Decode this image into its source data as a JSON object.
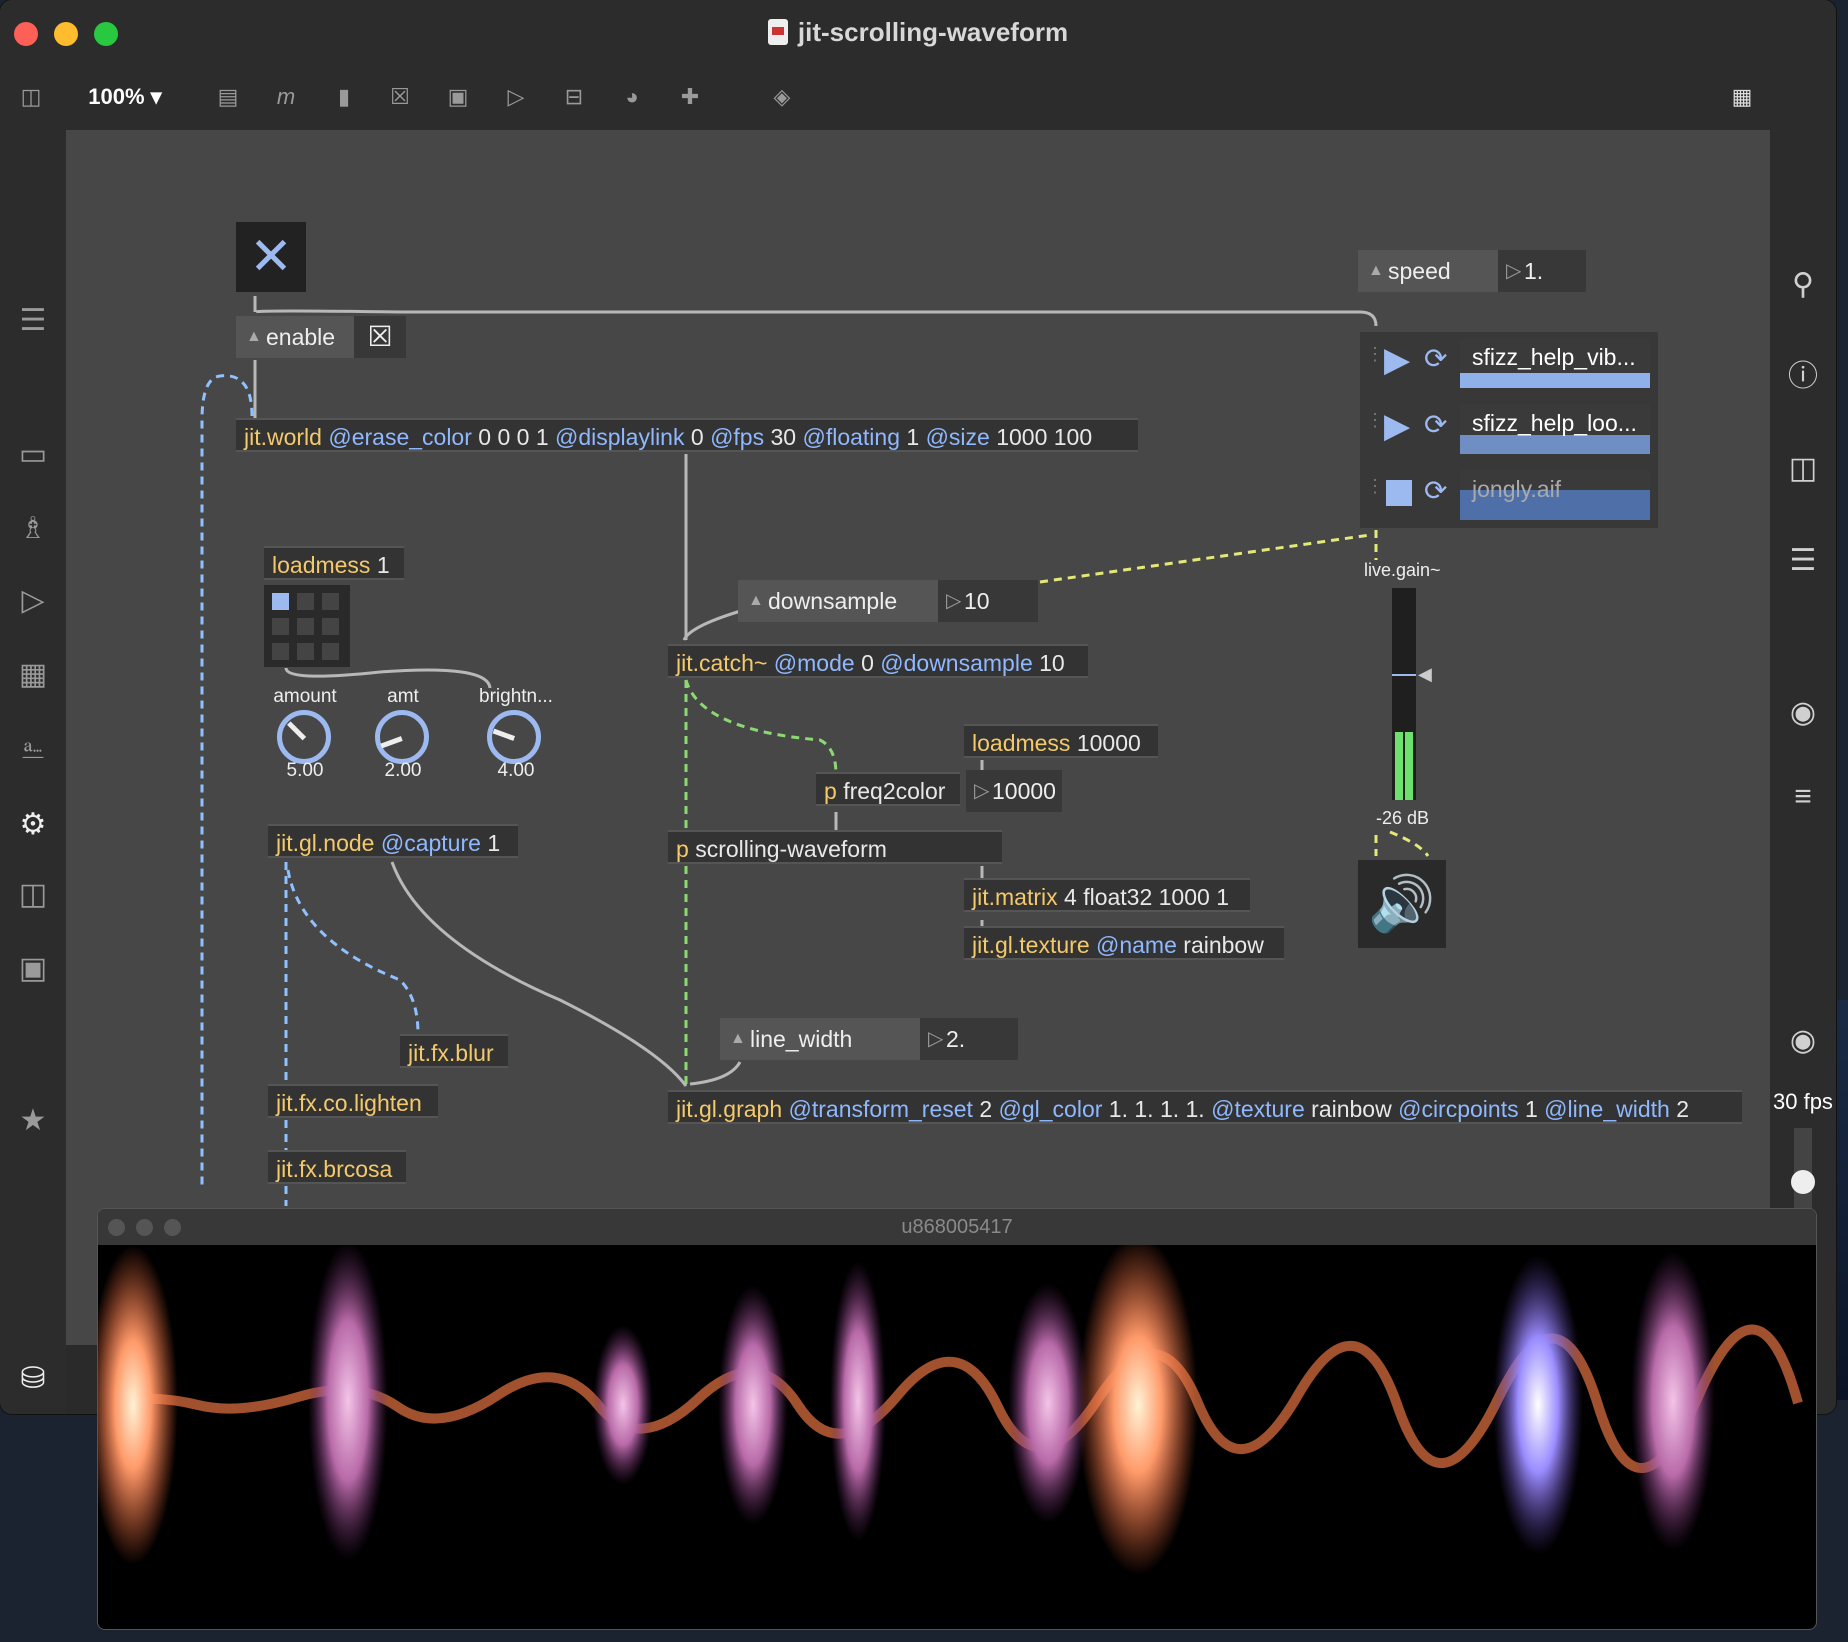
{
  "window": {
    "title": "jit-scrolling-waveform",
    "zoom": "100%"
  },
  "objects": {
    "world": {
      "name": "jit.world",
      "args": [
        [
          "@erase_color",
          "0 0 0 1"
        ],
        [
          "@displaylink",
          "0"
        ],
        [
          "@fps",
          "30"
        ],
        [
          "@floating",
          "1"
        ],
        [
          "@size",
          "1000 100"
        ]
      ]
    },
    "loadmess1": {
      "name": "loadmess",
      "rest": "1"
    },
    "catch": {
      "name": "jit.catch~",
      "args": [
        [
          "@mode",
          "0"
        ],
        [
          "@downsample",
          "10"
        ]
      ]
    },
    "loadmess2": {
      "name": "loadmess",
      "rest": "10000"
    },
    "freq2color": {
      "p": "p",
      "rest": "freq2color"
    },
    "scrolling": {
      "p": "p",
      "rest": "scrolling-waveform"
    },
    "matrix": {
      "name": "jit.matrix",
      "rest": "4 float32 1000 1"
    },
    "texture": {
      "name": "jit.gl.texture",
      "args": [
        [
          "@name",
          "rainbow"
        ]
      ]
    },
    "node": {
      "name": "jit.gl.node",
      "args": [
        [
          "@capture",
          "1"
        ]
      ]
    },
    "blur": {
      "name": "jit.fx.blur"
    },
    "lighten": {
      "name": "jit.fx.co.lighten"
    },
    "brcosa": {
      "name": "jit.fx.brcosa"
    },
    "graph": {
      "name": "jit.gl.graph",
      "args": [
        [
          "@transform_reset",
          "2"
        ],
        [
          "@gl_color",
          "1. 1. 1. 1."
        ],
        [
          "@texture",
          "rainbow"
        ],
        [
          "@circpoints",
          "1"
        ],
        [
          "@line_width",
          "2"
        ]
      ]
    }
  },
  "messages": {
    "enable": "enable",
    "speed": "speed",
    "downsample": "downsample",
    "line_width": "line_width"
  },
  "numbers": {
    "speed": "1.",
    "downsample": "10",
    "freq": "10000",
    "line_width": "2."
  },
  "dials": [
    {
      "label": "amount",
      "value": "5.00"
    },
    {
      "label": "amt",
      "value": "2.00"
    },
    {
      "label": "brightn...",
      "value": "4.00"
    }
  ],
  "playlist": [
    {
      "name": "sfizz_help_vib...",
      "state": "play"
    },
    {
      "name": "sfizz_help_loo...",
      "state": "play"
    },
    {
      "name": "jongly.aif",
      "state": "stop"
    }
  ],
  "gain": {
    "label": "live.gain~",
    "value": "-26 dB",
    "level": 0.27
  },
  "viewer": {
    "title": "u868005417",
    "fps": "30 fps"
  },
  "colors": {
    "object_name": "#f4c96a",
    "attribute": "#8fb8ff",
    "accent": "#9cb9f0",
    "meter": "#6de06d"
  }
}
